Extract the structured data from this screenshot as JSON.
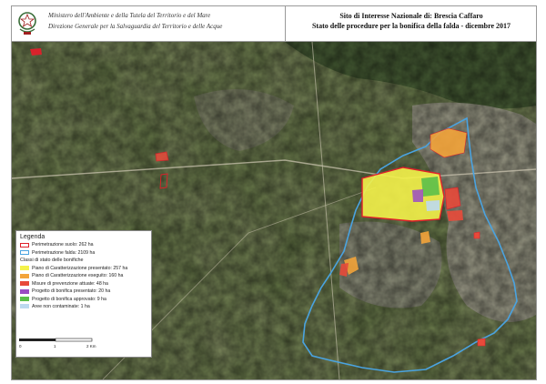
{
  "header": {
    "ministry_line1": "Ministero dell'Ambiente e della Tutela del Territorio e del Mare",
    "ministry_line2": "Direzione Generale per la Salvaguardia del Territorio e delle Acque",
    "title_line1": "Sito di Interesse Nazionale di: Brescia Caffaro",
    "title_line2": "Stato delle procedure per la bonifica della falda - dicembre 2017"
  },
  "legend": {
    "title": "Legenda",
    "perimeters": [
      {
        "label": "Perimetrazione suolo: 262 ha",
        "color": "#e0202a"
      },
      {
        "label": "Perimetrazione falda: 2109 ha",
        "color": "#4aa3e0"
      }
    ],
    "classes_title": "Classi di stato delle bonifiche",
    "classes": [
      {
        "label": "Piano di Caratterizzazione presentato: 257 ha",
        "color": "#f4f24a"
      },
      {
        "label": "Piano di Caratterizzazione eseguito: 160 ha",
        "color": "#f3a43a"
      },
      {
        "label": "Misure di prevenzione attuate: 48 ha",
        "color": "#e84a3a"
      },
      {
        "label": "Progetto di bonifica presentato: 20 ha",
        "color": "#9b4cc4"
      },
      {
        "label": "Progetto di bonifica approvato: 9 ha",
        "color": "#5bbf4a"
      },
      {
        "label": "Aree non contaminate: 1 ha",
        "color": "#bcd9ef"
      }
    ]
  },
  "scale": {
    "ticks": [
      "0",
      "1",
      "2 Km"
    ]
  }
}
